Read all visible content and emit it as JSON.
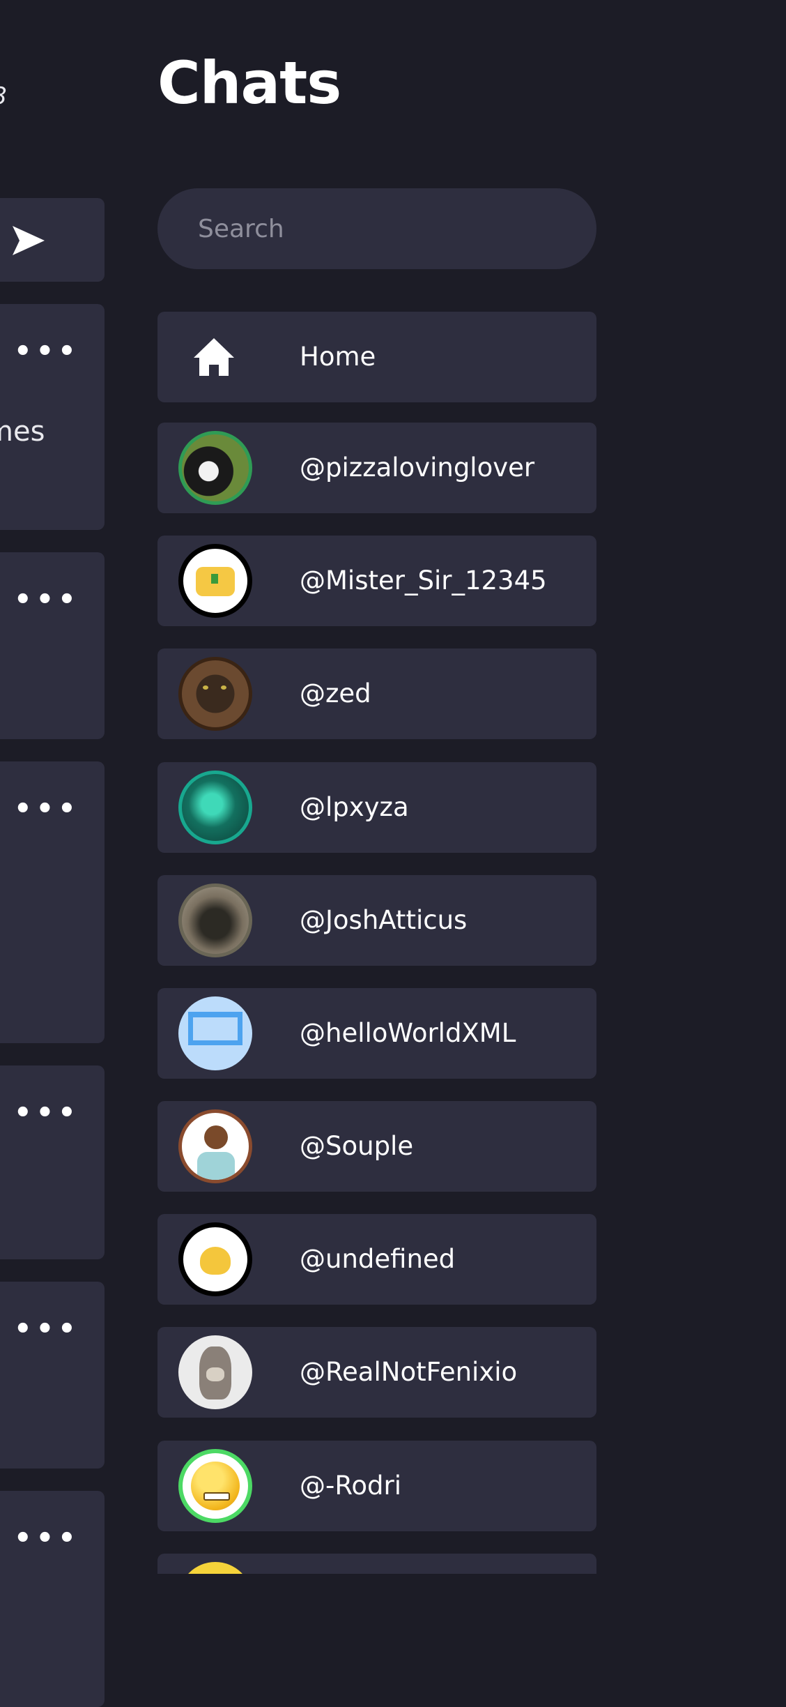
{
  "left_panel": {
    "time_fragment": "8",
    "post_text_fragment": "mes"
  },
  "chats": {
    "title": "Chats",
    "search_placeholder": "Search",
    "items": [
      {
        "label": "Home",
        "icon": "home-icon"
      },
      {
        "label": "@pizzalovinglover",
        "avatar_color": "#2f8f4a"
      },
      {
        "label": "@Mister_Sir_12345",
        "avatar_color": "#f5c844"
      },
      {
        "label": "@zed",
        "avatar_color": "#5a3a22"
      },
      {
        "label": "@lpxyza",
        "avatar_color": "#18897a"
      },
      {
        "label": "@JoshAtticus",
        "avatar_color": "#4a4738"
      },
      {
        "label": "@helloWorldXML",
        "avatar_color": "#7fbdf3"
      },
      {
        "label": "@Souple",
        "avatar_color": "#8a4b2e"
      },
      {
        "label": "@undefined",
        "avatar_color": "#f4c63c"
      },
      {
        "label": "@RealNotFenixio",
        "avatar_color": "#e8e8e8"
      },
      {
        "label": "@-Rodri",
        "avatar_color": "#4cd964"
      },
      {
        "label": "",
        "avatar_color": "#f5d33a"
      }
    ]
  },
  "colors": {
    "background": "#1c1c26",
    "card": "#2e2e3f",
    "text": "#ffffff",
    "placeholder": "#8f8f9c"
  }
}
